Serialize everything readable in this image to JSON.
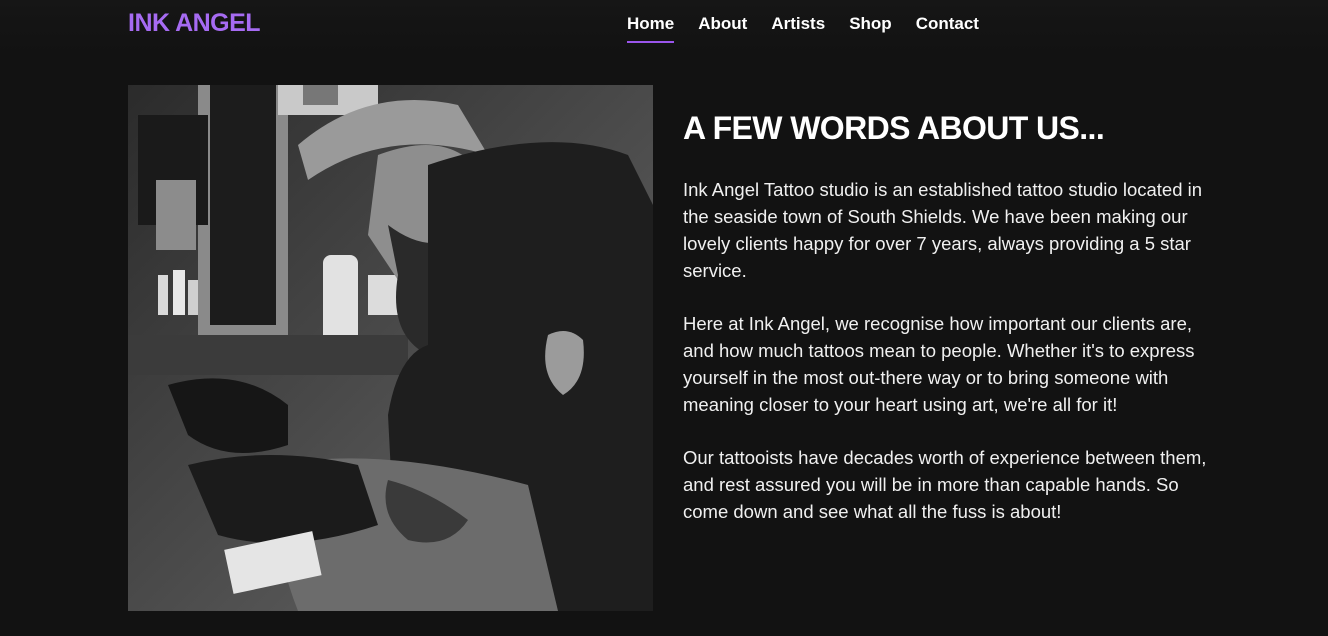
{
  "brand": {
    "logo_text": "INK ANGEL",
    "accent_color": "#a66bf2"
  },
  "nav": {
    "items": [
      {
        "label": "Home",
        "active": true
      },
      {
        "label": "About",
        "active": false
      },
      {
        "label": "Artists",
        "active": false
      },
      {
        "label": "Shop",
        "active": false
      },
      {
        "label": "Contact",
        "active": false
      }
    ]
  },
  "about": {
    "heading": "A FEW WORDS ABOUT US...",
    "paragraphs": [
      "Ink Angel Tattoo studio is an established tattoo studio located in the seaside town of South Shields. We have been making our lovely clients happy for over 7 years, always providing a 5 star service.",
      "Here at Ink Angel, we recognise how important our clients are, and how much tattoos mean to people. Whether it's to express yourself in the most out-there way or to bring someone with meaning closer to your heart using art, we're all for it!",
      "Our tattooists have decades worth of experience between them, and rest assured you will be in more than capable hands. So come down and see what all the fuss is about!"
    ]
  },
  "photo": {
    "description_icon": "tattoo-artist-photo"
  }
}
